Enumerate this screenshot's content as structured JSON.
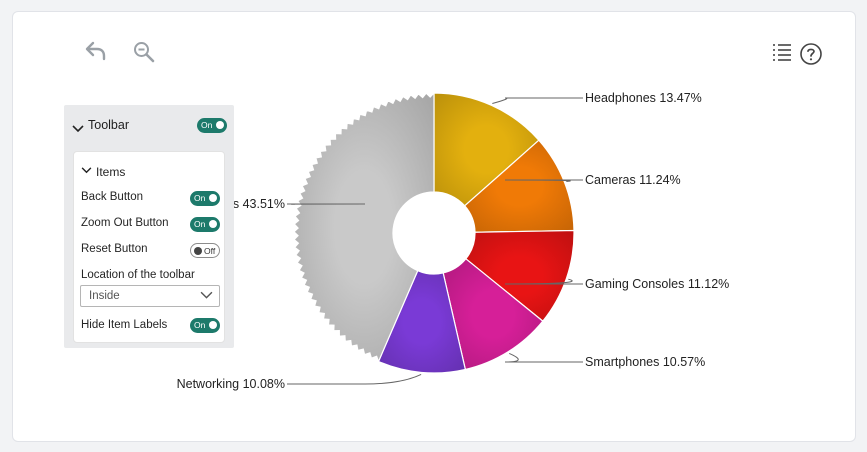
{
  "toolbar_icons": {
    "back": "undo-arrow-icon",
    "zoom_out": "zoom-out-icon",
    "legend": "list-icon",
    "help": "help-circle-icon"
  },
  "panel": {
    "title": "Toolbar",
    "toggle": "On",
    "items_title": "Items",
    "back_button": {
      "label": "Back Button",
      "toggle": "On"
    },
    "zoom_out_button": {
      "label": "Zoom Out Button",
      "toggle": "On"
    },
    "reset_button": {
      "label": "Reset Button",
      "toggle": "Off"
    },
    "location": {
      "label": "Location of the toolbar",
      "value": "Inside"
    },
    "hide_item_labels": {
      "label": "Hide Item Labels",
      "toggle": "On"
    }
  },
  "chart_data": {
    "type": "pie",
    "variant": "donut",
    "slices": [
      {
        "label": "Headphones 13.47%",
        "value": 13.47,
        "color": "#e3b00e"
      },
      {
        "label": "Cameras 11.24%",
        "value": 11.24,
        "color": "#f07a06"
      },
      {
        "label": "Gaming Consoles 11.12%",
        "value": 11.12,
        "color": "#e81414"
      },
      {
        "label": "Smartphones 10.57%",
        "value": 10.57,
        "color": "#d61f98"
      },
      {
        "label": "Networking 10.08%",
        "value": 10.08,
        "color": "#7a3ad6"
      },
      {
        "label": "s 43.51%",
        "value": 43.51,
        "color": "#c9c9c9"
      }
    ]
  }
}
